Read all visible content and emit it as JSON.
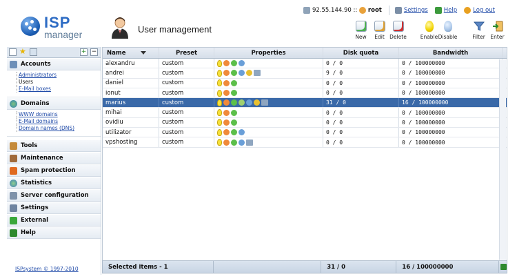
{
  "topbar": {
    "ip": "92.55.144.90 ::",
    "user": "root",
    "settings": "Settings",
    "help": "Help",
    "logout": "Log out"
  },
  "logo": {
    "isp": "ISP",
    "manager": "manager"
  },
  "page": {
    "title": "User management"
  },
  "toolbar": {
    "new": "New",
    "edit": "Edit",
    "delete": "Delete",
    "enable": "Enable",
    "disable": "Disable",
    "filter": "Filter",
    "enter": "Enter"
  },
  "sidebar": {
    "accounts": {
      "title": "Accounts",
      "items": [
        "Administrators",
        "Users",
        "E-Mail boxes"
      ]
    },
    "domains": {
      "title": "Domains",
      "items": [
        "WWW domains",
        "E-Mail domains",
        "Domain names (DNS)"
      ]
    },
    "sections": [
      "Tools",
      "Maintenance",
      "Spam protection",
      "Statistics",
      "Server configuration",
      "Settings",
      "External",
      "Help"
    ],
    "copyright": "ISPsystem © 1997-2010"
  },
  "table": {
    "headers": {
      "name": "Name",
      "preset": "Preset",
      "properties": "Properties",
      "quota": "Disk quota",
      "bandwidth": "Bandwidth"
    },
    "rows": [
      {
        "name": "alexandru",
        "preset": "custom",
        "quota": "0 / 0",
        "bandwidth": "0 / 100000000"
      },
      {
        "name": "andrei",
        "preset": "custom",
        "quota": "9 / 0",
        "bandwidth": "0 / 100000000"
      },
      {
        "name": "daniel",
        "preset": "custom",
        "quota": "0 / 0",
        "bandwidth": "0 / 100000000"
      },
      {
        "name": "ionut",
        "preset": "custom",
        "quota": "0 / 0",
        "bandwidth": "0 / 100000000"
      },
      {
        "name": "marius",
        "preset": "custom",
        "quota": "31 / 0",
        "bandwidth": "16 / 100000000"
      },
      {
        "name": "mihai",
        "preset": "custom",
        "quota": "0 / 0",
        "bandwidth": "0 / 100000000"
      },
      {
        "name": "ovidiu",
        "preset": "custom",
        "quota": "0 / 0",
        "bandwidth": "0 / 100000000"
      },
      {
        "name": "utilizator",
        "preset": "custom",
        "quota": "0 / 0",
        "bandwidth": "0 / 100000000"
      },
      {
        "name": "vpshosting",
        "preset": "custom",
        "quota": "0 / 0",
        "bandwidth": "0 / 100000000"
      }
    ],
    "footer": {
      "selected": "Selected items - 1",
      "quota": "31 / 0",
      "bandwidth": "16 / 100000000"
    }
  },
  "colors": {
    "accent": "#3a69a8",
    "link": "#1f4aa8"
  }
}
